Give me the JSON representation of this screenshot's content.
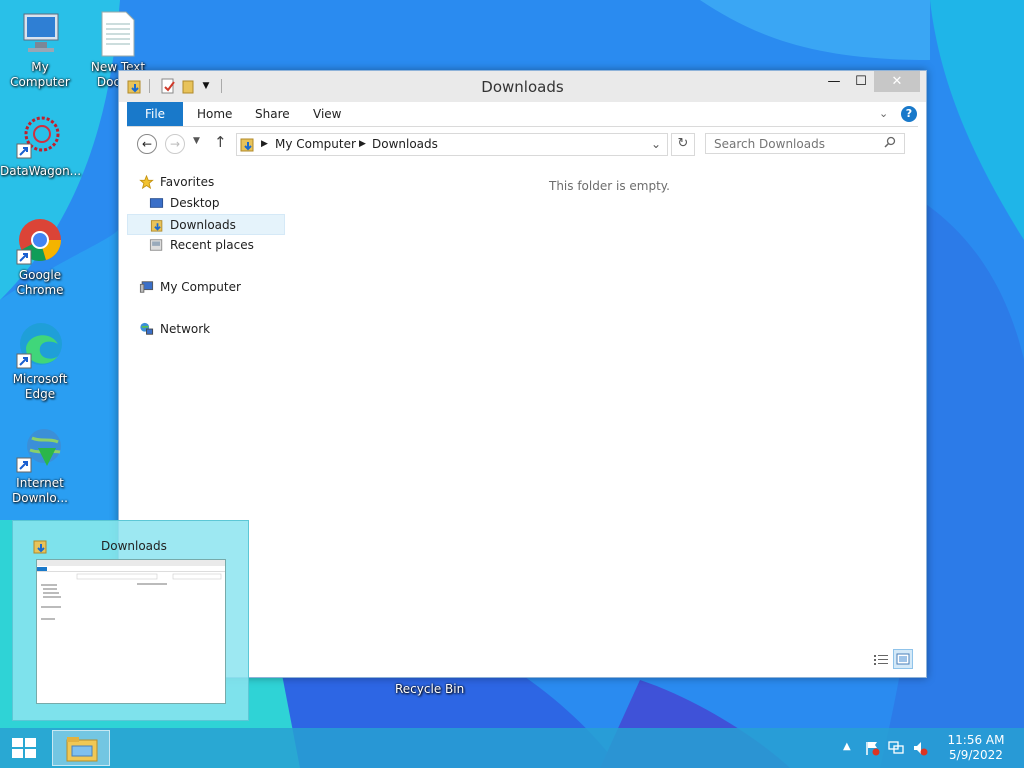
{
  "desktop": {
    "icons": [
      {
        "label": "My Computer",
        "icon": "computer-icon"
      },
      {
        "label": "New Text Docu...",
        "icon": "text-document-icon"
      },
      {
        "label": "DataWagon...",
        "icon": "datawagon-icon"
      },
      {
        "label": "Google Chrome",
        "icon": "chrome-icon"
      },
      {
        "label": "Microsoft Edge",
        "icon": "edge-icon"
      },
      {
        "label": "Internet Downlo...",
        "icon": "internet-download-manager-icon"
      }
    ],
    "recycle_bin_label": "Recycle Bin"
  },
  "window": {
    "title": "Downloads",
    "controls": {
      "minimize": "—",
      "maximize": "☐",
      "close": "✕"
    },
    "ribbon_tabs": [
      "File",
      "Home",
      "Share",
      "View"
    ],
    "address": {
      "crumbs": [
        "My Computer",
        "Downloads"
      ]
    },
    "search_placeholder": "Search Downloads",
    "nav_pane": {
      "favorites_label": "Favorites",
      "favorites": [
        "Desktop",
        "Downloads",
        "Recent places"
      ],
      "selected": "Downloads",
      "my_computer_label": "My Computer",
      "network_label": "Network"
    },
    "empty_message": "This folder is empty.",
    "accent_color": "#1979ca"
  },
  "taskbar": {
    "thumbnail_title": "Downloads",
    "time": "11:56 AM",
    "date": "5/9/2022",
    "color": "#28a0d2"
  }
}
